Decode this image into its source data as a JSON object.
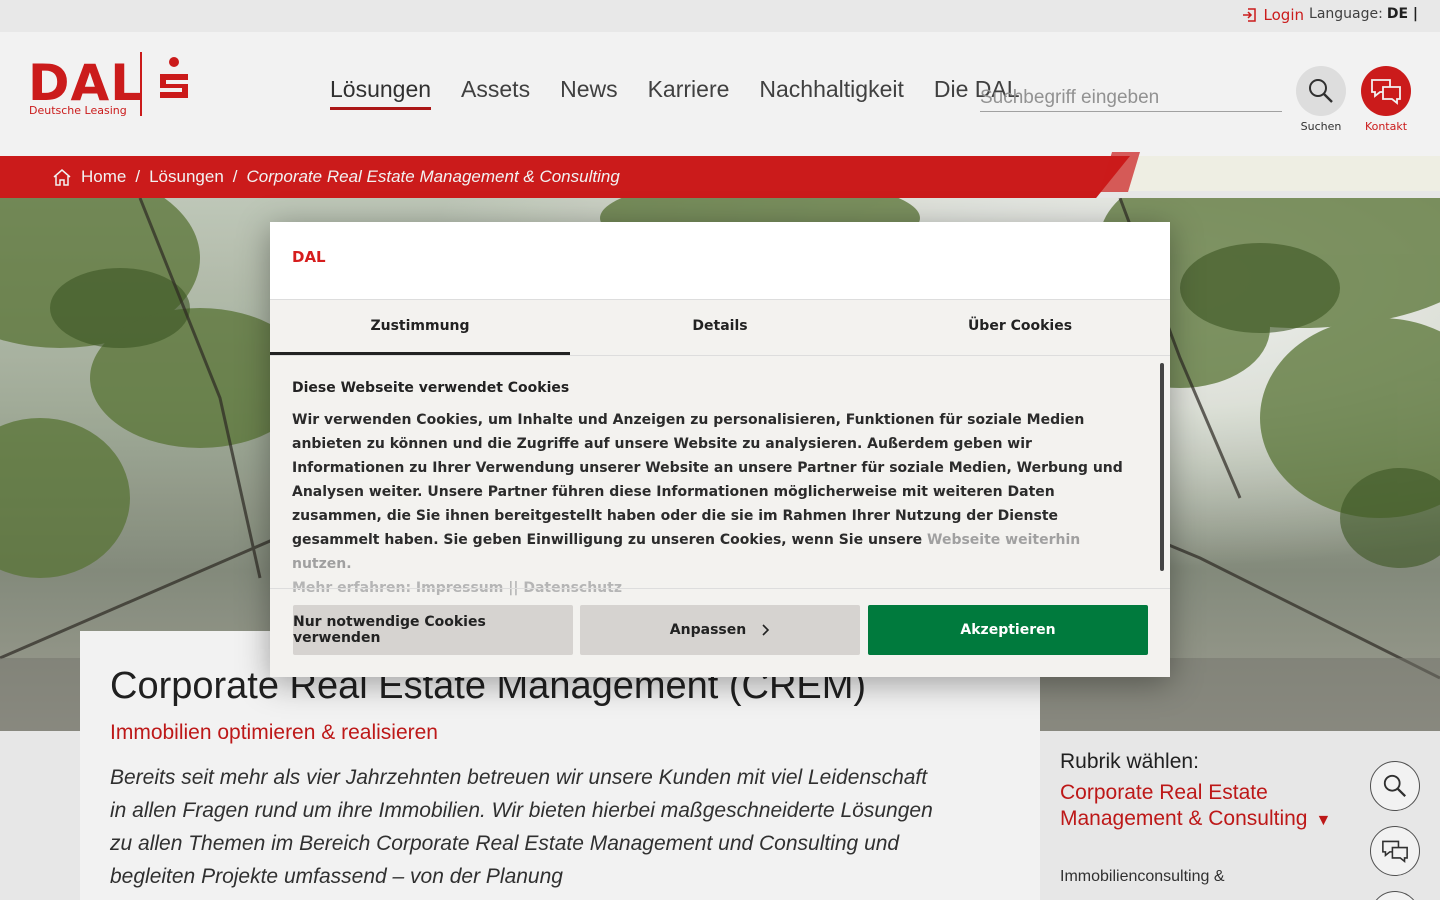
{
  "topbar": {
    "login_label": "Login",
    "language_label": "Language:",
    "language_value": "DE |"
  },
  "logo": {
    "wordmark": "DAL",
    "subtitle": "Deutsche Leasing"
  },
  "nav": {
    "items": [
      "Lösungen",
      "Assets",
      "News",
      "Karriere",
      "Nachhaltigkeit",
      "Die DAL"
    ],
    "active": "Lösungen"
  },
  "header": {
    "search_placeholder": "Suchbegriff eingeben",
    "search_label": "Suchen",
    "contact_label": "Kontakt"
  },
  "breadcrumb": {
    "items": [
      "Home",
      "Lösungen",
      "Corporate Real Estate Management & Consulting"
    ],
    "separator": "/"
  },
  "content": {
    "title": "Corporate Real Estate Management (CREM)",
    "subtitle": "Immobilien optimieren & realisieren",
    "intro": "Bereits seit mehr als vier Jahrzehnten betreuen wir unsere Kunden mit viel Leidenschaft in allen Fragen rund um ihre Immobilien. Wir bieten hierbei maßgeschneiderte Lösungen zu allen Themen im Bereich Corporate Real Estate Management und Consulting und begleiten Projekte umfassend – von der Planung"
  },
  "sidebar": {
    "rubrik_label": "Rubrik wählen:",
    "selected": "Corporate Real Estate Management & Consulting",
    "arrow": "▼",
    "sub_item": "Immobilienconsulting &"
  },
  "cookie_dialog": {
    "brand": "DAL",
    "tabs": [
      "Zustimmung",
      "Details",
      "Über Cookies"
    ],
    "active_tab": "Zustimmung",
    "heading": "Diese Webseite verwendet Cookies",
    "body": "Wir verwenden Cookies, um Inhalte und Anzeigen zu personalisieren, Funktionen für soziale Medien anbieten zu können und die Zugriffe auf unsere Website zu analysieren. Außerdem geben wir Informationen zu Ihrer Verwendung unserer Website an unsere Partner für soziale Medien, Werbung und Analysen weiter. Unsere Partner führen diese Informationen möglicherweise mit weiteren Daten zusammen, die Sie ihnen bereitgestellt haben oder die sie im Rahmen Ihrer Nutzung der Dienste gesammelt haben. Sie geben Einwilligung zu unseren Cookies, wenn Sie unsere",
    "body_faded": "Webseite weiterhin nutzen.",
    "more_prefix": "Mehr erfahren:",
    "more_links": [
      "Impressum",
      "Datenschutz"
    ],
    "more_separator": "||",
    "buttons": {
      "necessary": "Nur notwendige Cookies verwenden",
      "customize": "Anpassen",
      "accept": "Akzeptieren"
    }
  },
  "colors": {
    "brand_red": "#d61d1d",
    "accept_green": "#007a3d",
    "button_grey": "#d6d3d0"
  },
  "icons": [
    "login-icon",
    "search-icon",
    "chat-icon",
    "home-icon",
    "chevron-right-icon",
    "sparkasse-s-icon"
  ]
}
